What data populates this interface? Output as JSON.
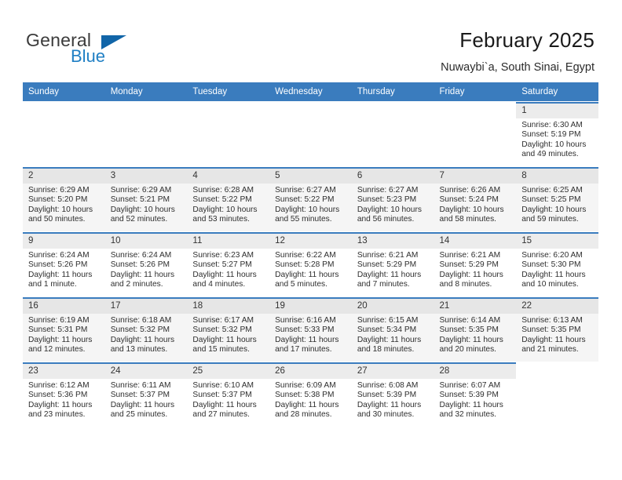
{
  "brand": {
    "name_part1": "General",
    "name_part2": "Blue",
    "triangle_color": "#1165a8",
    "blue_color": "#1f7fc4"
  },
  "header": {
    "title": "February 2025",
    "subtitle": "Nuwaybi`a, South Sinai, Egypt",
    "header_bg": "#3a7cbe",
    "header_text_color": "#ffffff"
  },
  "weekdays": [
    "Sunday",
    "Monday",
    "Tuesday",
    "Wednesday",
    "Thursday",
    "Friday",
    "Saturday"
  ],
  "weeks": [
    [
      {
        "day": ""
      },
      {
        "day": ""
      },
      {
        "day": ""
      },
      {
        "day": ""
      },
      {
        "day": ""
      },
      {
        "day": ""
      },
      {
        "day": "1",
        "sunrise": "Sunrise: 6:30 AM",
        "sunset": "Sunset: 5:19 PM",
        "daylight": "Daylight: 10 hours and 49 minutes."
      }
    ],
    [
      {
        "day": "2",
        "sunrise": "Sunrise: 6:29 AM",
        "sunset": "Sunset: 5:20 PM",
        "daylight": "Daylight: 10 hours and 50 minutes."
      },
      {
        "day": "3",
        "sunrise": "Sunrise: 6:29 AM",
        "sunset": "Sunset: 5:21 PM",
        "daylight": "Daylight: 10 hours and 52 minutes."
      },
      {
        "day": "4",
        "sunrise": "Sunrise: 6:28 AM",
        "sunset": "Sunset: 5:22 PM",
        "daylight": "Daylight: 10 hours and 53 minutes."
      },
      {
        "day": "5",
        "sunrise": "Sunrise: 6:27 AM",
        "sunset": "Sunset: 5:22 PM",
        "daylight": "Daylight: 10 hours and 55 minutes."
      },
      {
        "day": "6",
        "sunrise": "Sunrise: 6:27 AM",
        "sunset": "Sunset: 5:23 PM",
        "daylight": "Daylight: 10 hours and 56 minutes."
      },
      {
        "day": "7",
        "sunrise": "Sunrise: 6:26 AM",
        "sunset": "Sunset: 5:24 PM",
        "daylight": "Daylight: 10 hours and 58 minutes."
      },
      {
        "day": "8",
        "sunrise": "Sunrise: 6:25 AM",
        "sunset": "Sunset: 5:25 PM",
        "daylight": "Daylight: 10 hours and 59 minutes."
      }
    ],
    [
      {
        "day": "9",
        "sunrise": "Sunrise: 6:24 AM",
        "sunset": "Sunset: 5:26 PM",
        "daylight": "Daylight: 11 hours and 1 minute."
      },
      {
        "day": "10",
        "sunrise": "Sunrise: 6:24 AM",
        "sunset": "Sunset: 5:26 PM",
        "daylight": "Daylight: 11 hours and 2 minutes."
      },
      {
        "day": "11",
        "sunrise": "Sunrise: 6:23 AM",
        "sunset": "Sunset: 5:27 PM",
        "daylight": "Daylight: 11 hours and 4 minutes."
      },
      {
        "day": "12",
        "sunrise": "Sunrise: 6:22 AM",
        "sunset": "Sunset: 5:28 PM",
        "daylight": "Daylight: 11 hours and 5 minutes."
      },
      {
        "day": "13",
        "sunrise": "Sunrise: 6:21 AM",
        "sunset": "Sunset: 5:29 PM",
        "daylight": "Daylight: 11 hours and 7 minutes."
      },
      {
        "day": "14",
        "sunrise": "Sunrise: 6:21 AM",
        "sunset": "Sunset: 5:29 PM",
        "daylight": "Daylight: 11 hours and 8 minutes."
      },
      {
        "day": "15",
        "sunrise": "Sunrise: 6:20 AM",
        "sunset": "Sunset: 5:30 PM",
        "daylight": "Daylight: 11 hours and 10 minutes."
      }
    ],
    [
      {
        "day": "16",
        "sunrise": "Sunrise: 6:19 AM",
        "sunset": "Sunset: 5:31 PM",
        "daylight": "Daylight: 11 hours and 12 minutes."
      },
      {
        "day": "17",
        "sunrise": "Sunrise: 6:18 AM",
        "sunset": "Sunset: 5:32 PM",
        "daylight": "Daylight: 11 hours and 13 minutes."
      },
      {
        "day": "18",
        "sunrise": "Sunrise: 6:17 AM",
        "sunset": "Sunset: 5:32 PM",
        "daylight": "Daylight: 11 hours and 15 minutes."
      },
      {
        "day": "19",
        "sunrise": "Sunrise: 6:16 AM",
        "sunset": "Sunset: 5:33 PM",
        "daylight": "Daylight: 11 hours and 17 minutes."
      },
      {
        "day": "20",
        "sunrise": "Sunrise: 6:15 AM",
        "sunset": "Sunset: 5:34 PM",
        "daylight": "Daylight: 11 hours and 18 minutes."
      },
      {
        "day": "21",
        "sunrise": "Sunrise: 6:14 AM",
        "sunset": "Sunset: 5:35 PM",
        "daylight": "Daylight: 11 hours and 20 minutes."
      },
      {
        "day": "22",
        "sunrise": "Sunrise: 6:13 AM",
        "sunset": "Sunset: 5:35 PM",
        "daylight": "Daylight: 11 hours and 21 minutes."
      }
    ],
    [
      {
        "day": "23",
        "sunrise": "Sunrise: 6:12 AM",
        "sunset": "Sunset: 5:36 PM",
        "daylight": "Daylight: 11 hours and 23 minutes."
      },
      {
        "day": "24",
        "sunrise": "Sunrise: 6:11 AM",
        "sunset": "Sunset: 5:37 PM",
        "daylight": "Daylight: 11 hours and 25 minutes."
      },
      {
        "day": "25",
        "sunrise": "Sunrise: 6:10 AM",
        "sunset": "Sunset: 5:37 PM",
        "daylight": "Daylight: 11 hours and 27 minutes."
      },
      {
        "day": "26",
        "sunrise": "Sunrise: 6:09 AM",
        "sunset": "Sunset: 5:38 PM",
        "daylight": "Daylight: 11 hours and 28 minutes."
      },
      {
        "day": "27",
        "sunrise": "Sunrise: 6:08 AM",
        "sunset": "Sunset: 5:39 PM",
        "daylight": "Daylight: 11 hours and 30 minutes."
      },
      {
        "day": "28",
        "sunrise": "Sunrise: 6:07 AM",
        "sunset": "Sunset: 5:39 PM",
        "daylight": "Daylight: 11 hours and 32 minutes."
      },
      {
        "day": ""
      }
    ]
  ]
}
